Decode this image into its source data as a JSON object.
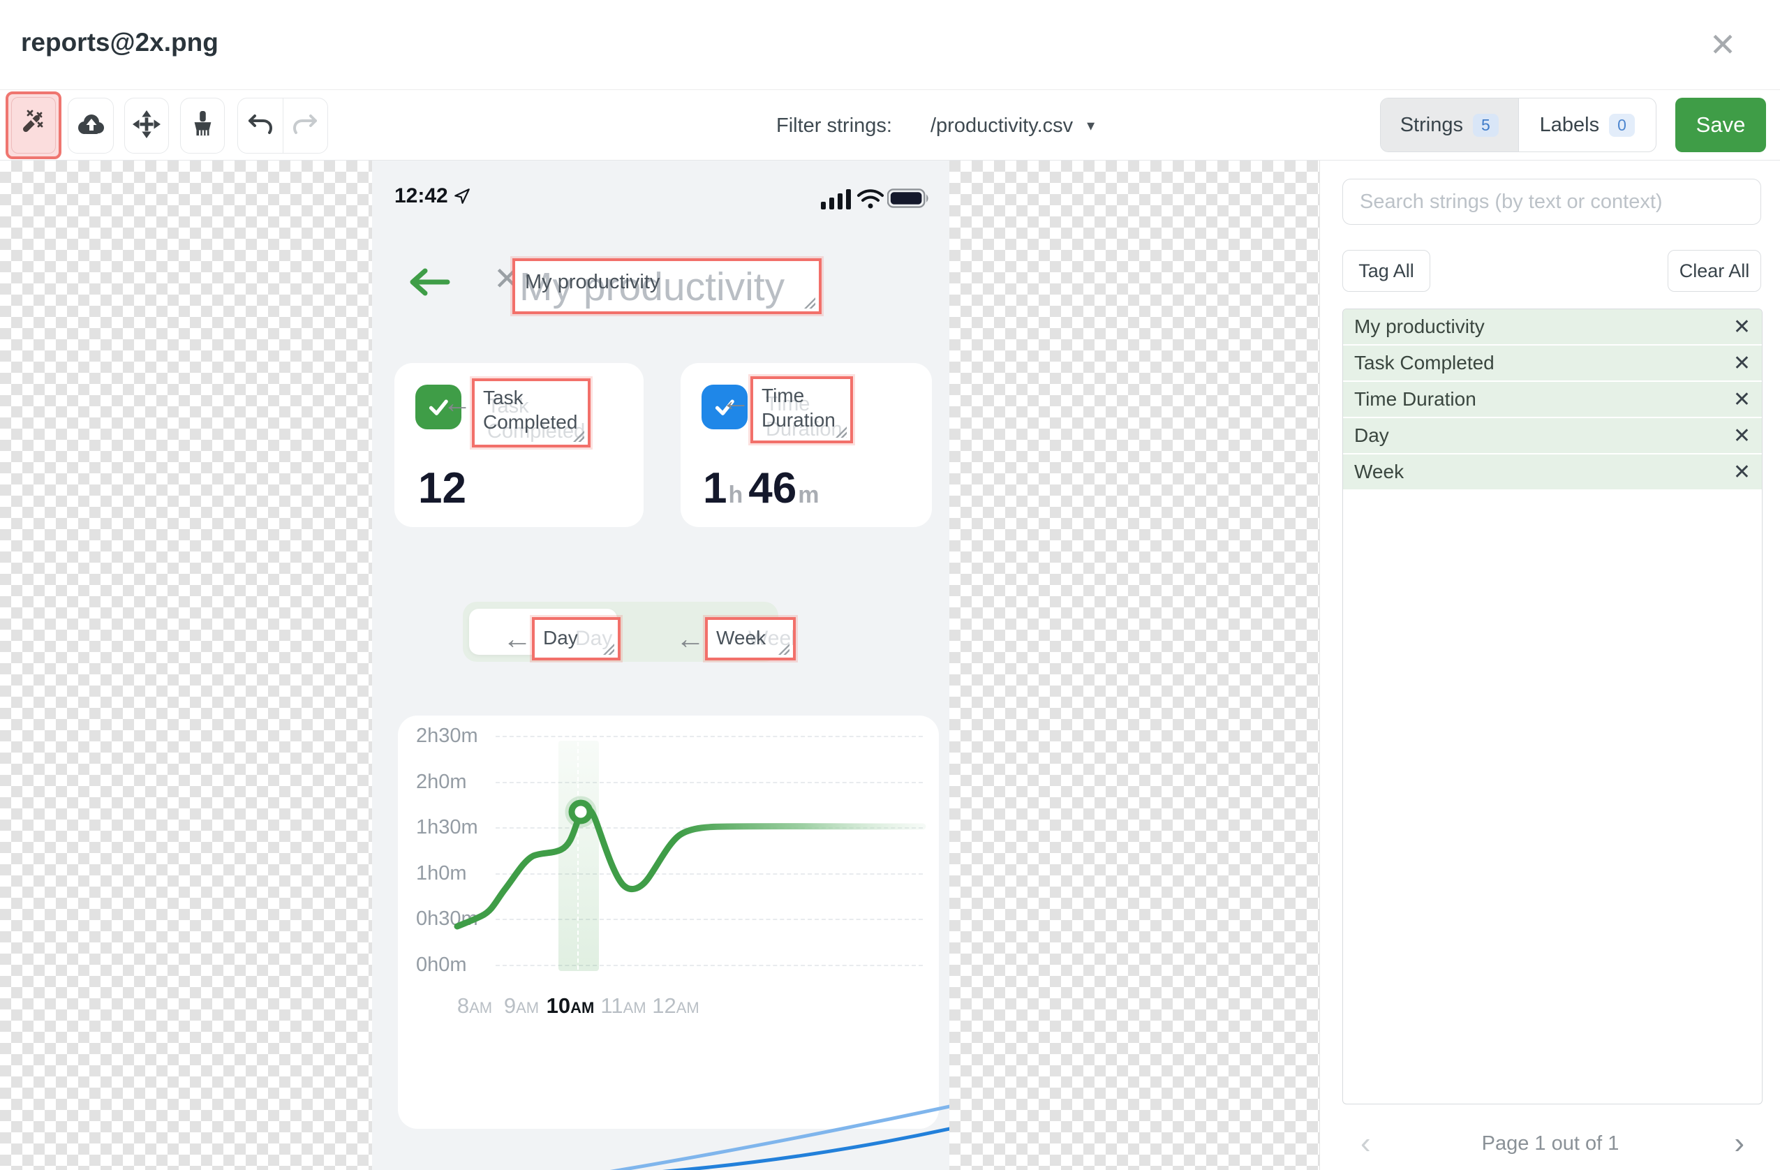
{
  "header": {
    "title": "reports@2x.png"
  },
  "toolbar": {
    "filter_label": "Filter strings:",
    "filter_value": "/productivity.csv",
    "tabs": {
      "strings_label": "Strings",
      "strings_count": "5",
      "labels_label": "Labels",
      "labels_count": "0"
    },
    "save_label": "Save"
  },
  "sidebar": {
    "search_placeholder": "Search strings (by text or context)",
    "tag_all_label": "Tag All",
    "clear_all_label": "Clear All",
    "strings": [
      "My productivity",
      "Task Completed",
      "Time Duration",
      "Day",
      "Week"
    ],
    "pagination": "Page 1 out of 1"
  },
  "phone": {
    "status_time": "12:42",
    "screen_title": "My productivity",
    "task_card": {
      "label_line1": "Task",
      "label_line2": "Completed",
      "value": "12"
    },
    "time_card": {
      "label_line1": "Time",
      "label_line2": "Duration",
      "hours": "1",
      "hours_unit": "h",
      "minutes": "46",
      "minutes_unit": "m"
    },
    "toggle": {
      "day": "Day",
      "week": "Week"
    }
  },
  "chart_data": {
    "type": "line",
    "title": "",
    "x_labels": [
      "8AM",
      "9AM",
      "10AM",
      "11AM",
      "12AM"
    ],
    "x_nums": [
      "8",
      "9",
      "10",
      "11",
      "12"
    ],
    "x_suffix": "AM",
    "y_tick_labels": [
      "0h0m",
      "0h30m",
      "1h0m",
      "1h30m",
      "2h0m",
      "2h30m"
    ],
    "ylim_minutes": [
      0,
      150
    ],
    "series": [
      {
        "name": "Time Duration",
        "unit": "minutes",
        "x": [
          "8AM",
          "9AM",
          "10AM",
          "11AM",
          "12AM"
        ],
        "values": [
          27,
          72,
          103,
          50,
          88
        ]
      }
    ],
    "highlighted_x": "10AM",
    "marker": {
      "x": "10AM",
      "value_minutes": 103
    },
    "grid": "dashed-horizontal",
    "legend": "none"
  },
  "icons": {
    "close": "✕",
    "remove": "✕",
    "caret_down": "▾",
    "chevron_left": "‹",
    "chevron_right": "›",
    "pointer_arrow": "←"
  },
  "colors": {
    "accent_green": "#3f9d47",
    "accent_blue": "#1f87e8",
    "tag_border_red": "#f2706a",
    "wand_highlight_pink": "#fbdddd",
    "list_row_green": "#e6f1e7",
    "badge_blue_bg": "#d9e6f7",
    "badge_blue_text": "#3e7bc8"
  }
}
